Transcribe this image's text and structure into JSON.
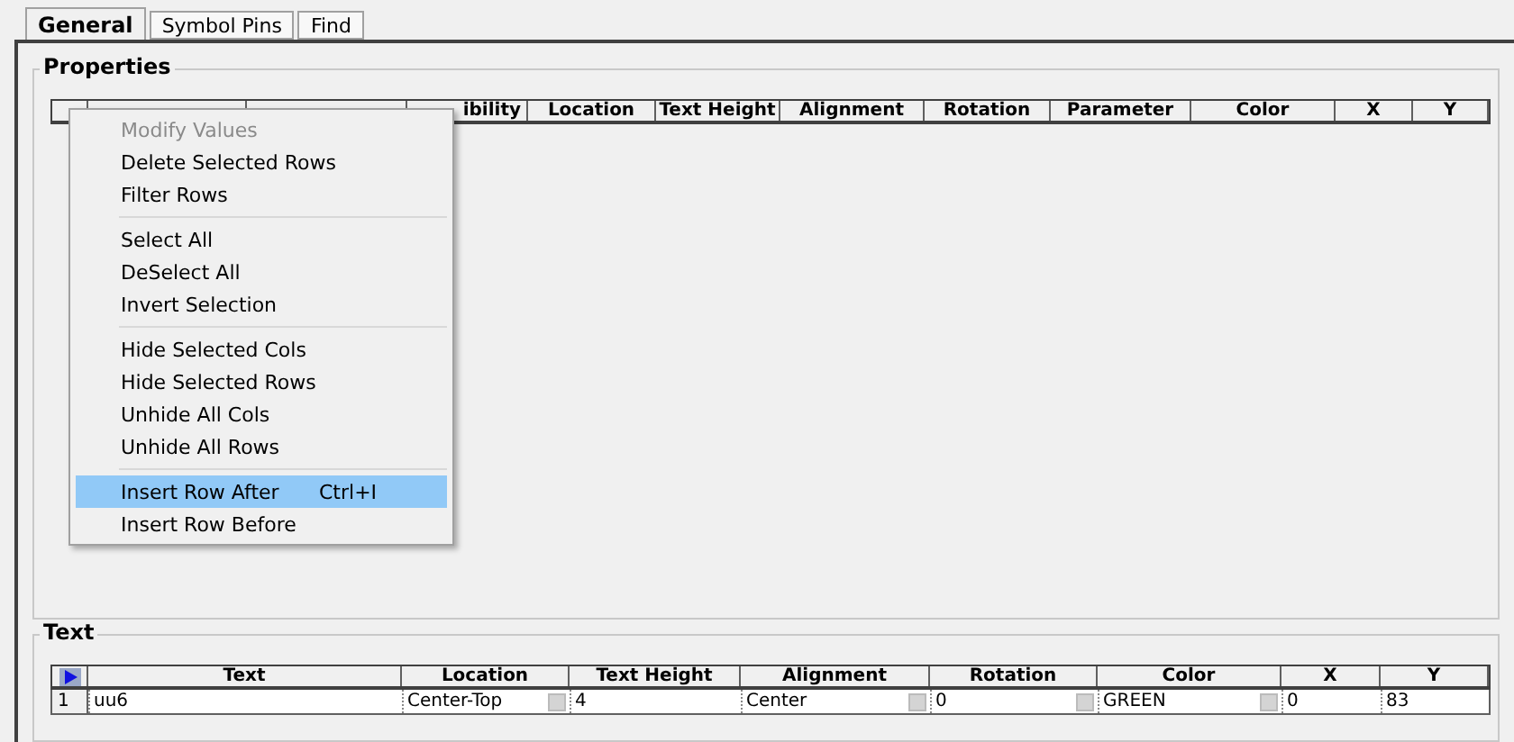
{
  "tabs": [
    {
      "label": "General",
      "selected": true
    },
    {
      "label": "Symbol Pins",
      "selected": false
    },
    {
      "label": "Find",
      "selected": false
    }
  ],
  "properties": {
    "title": "Properties",
    "columns": [
      {},
      {},
      {
        "label": "ibility"
      },
      {
        "label": "Location"
      },
      {
        "label": "Text Height"
      },
      {
        "label": "Alignment"
      },
      {
        "label": "Rotation"
      },
      {
        "label": "Parameter"
      },
      {
        "label": "Color"
      },
      {
        "label": "X"
      },
      {
        "label": "Y"
      }
    ]
  },
  "context_menu": {
    "groups": [
      [
        {
          "label": "Modify Values",
          "disabled": true,
          "selected": false
        },
        {
          "label": "Delete Selected Rows",
          "disabled": false,
          "selected": false
        },
        {
          "label": "Filter Rows",
          "disabled": false,
          "selected": false
        }
      ],
      [
        {
          "label": "Select All",
          "disabled": false,
          "selected": false
        },
        {
          "label": "DeSelect All",
          "disabled": false,
          "selected": false
        },
        {
          "label": "Invert Selection",
          "disabled": false,
          "selected": false
        }
      ],
      [
        {
          "label": "Hide Selected Cols",
          "disabled": false,
          "selected": false
        },
        {
          "label": "Hide Selected Rows",
          "disabled": false,
          "selected": false
        },
        {
          "label": "Unhide All Cols",
          "disabled": false,
          "selected": false
        },
        {
          "label": "Unhide All Rows",
          "disabled": false,
          "selected": false
        }
      ],
      [
        {
          "label": "Insert Row After",
          "shortcut": "Ctrl+I",
          "disabled": false,
          "selected": true
        },
        {
          "label": "Insert Row Before",
          "disabled": false,
          "selected": false
        }
      ]
    ]
  },
  "text": {
    "title": "Text",
    "columns": [
      {
        "label": "Text",
        "dropdown": false
      },
      {
        "label": "Location",
        "dropdown": true
      },
      {
        "label": "Text Height",
        "dropdown": false
      },
      {
        "label": "Alignment",
        "dropdown": true
      },
      {
        "label": "Rotation",
        "dropdown": true
      },
      {
        "label": "Color",
        "dropdown": true
      },
      {
        "label": "X",
        "dropdown": false
      },
      {
        "label": "Y",
        "dropdown": false
      }
    ],
    "rows": [
      {
        "number": "1",
        "cells": [
          "uu6",
          "Center-Top",
          "4",
          "Center",
          "0",
          "GREEN",
          "0",
          "83"
        ]
      }
    ]
  }
}
